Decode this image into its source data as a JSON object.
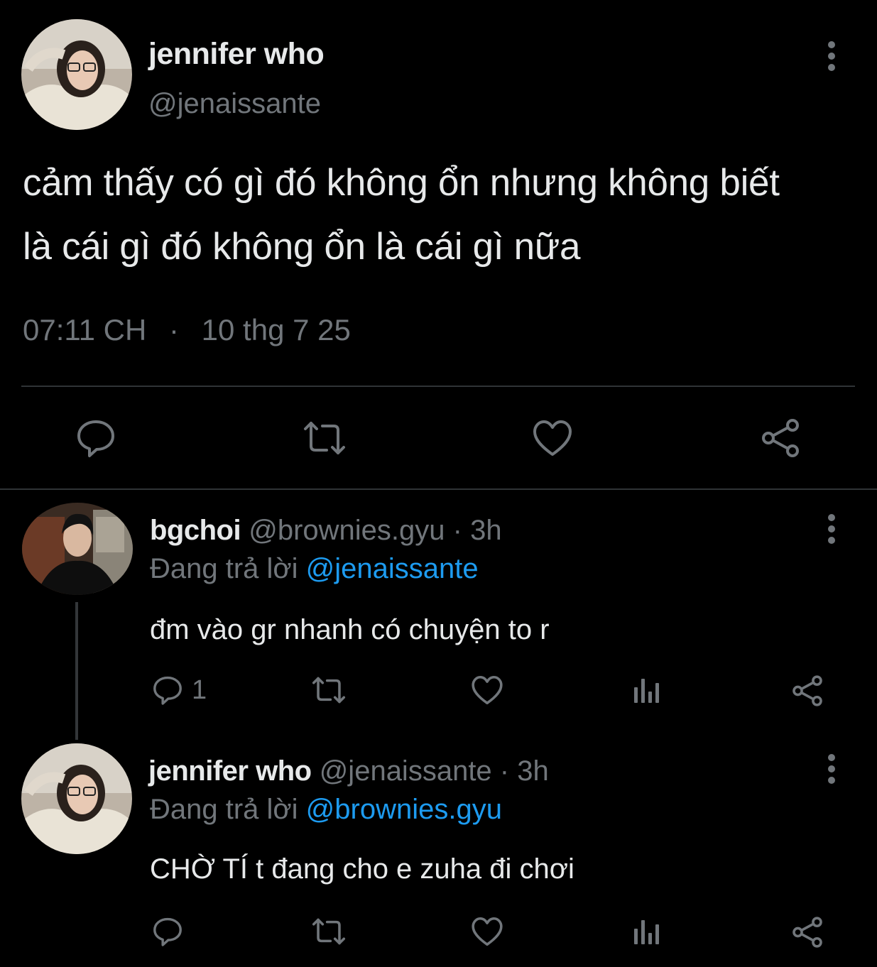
{
  "tweet": {
    "author_name": "jennifer who",
    "author_handle": "@jenaissante",
    "text_line1": "cảm thấy có gì đó không ổn nhưng không biết",
    "text_line2": "là cái gì đó không ổn là cái gì nữa",
    "time": "07:11 CH",
    "separator": "·",
    "date": "10 thg 7 25",
    "actions": [
      "reply-icon",
      "retweet-icon",
      "like-icon",
      "share-icon"
    ]
  },
  "replies": [
    {
      "author_name": "bgchoi",
      "author_handle": "@brownies.gyu",
      "age": "· 3h",
      "replying_prefix": "Đang trả lời",
      "replying_to": "@jenaissante",
      "text": "đm vào gr nhanh có chuyện to r",
      "reply_count": "1"
    },
    {
      "author_name": "jennifer who",
      "author_handle": "@jenaissante",
      "age": "· 3h",
      "replying_prefix": "Đang trả lời",
      "replying_to": "@brownies.gyu",
      "text": "CHỜ TÍ t đang cho e zuha đi chơi",
      "reply_count": ""
    }
  ],
  "colors": {
    "background": "#000000",
    "text": "#e7e9ea",
    "muted": "#71767b",
    "link": "#1d9bf0",
    "divider": "#2f3336"
  }
}
